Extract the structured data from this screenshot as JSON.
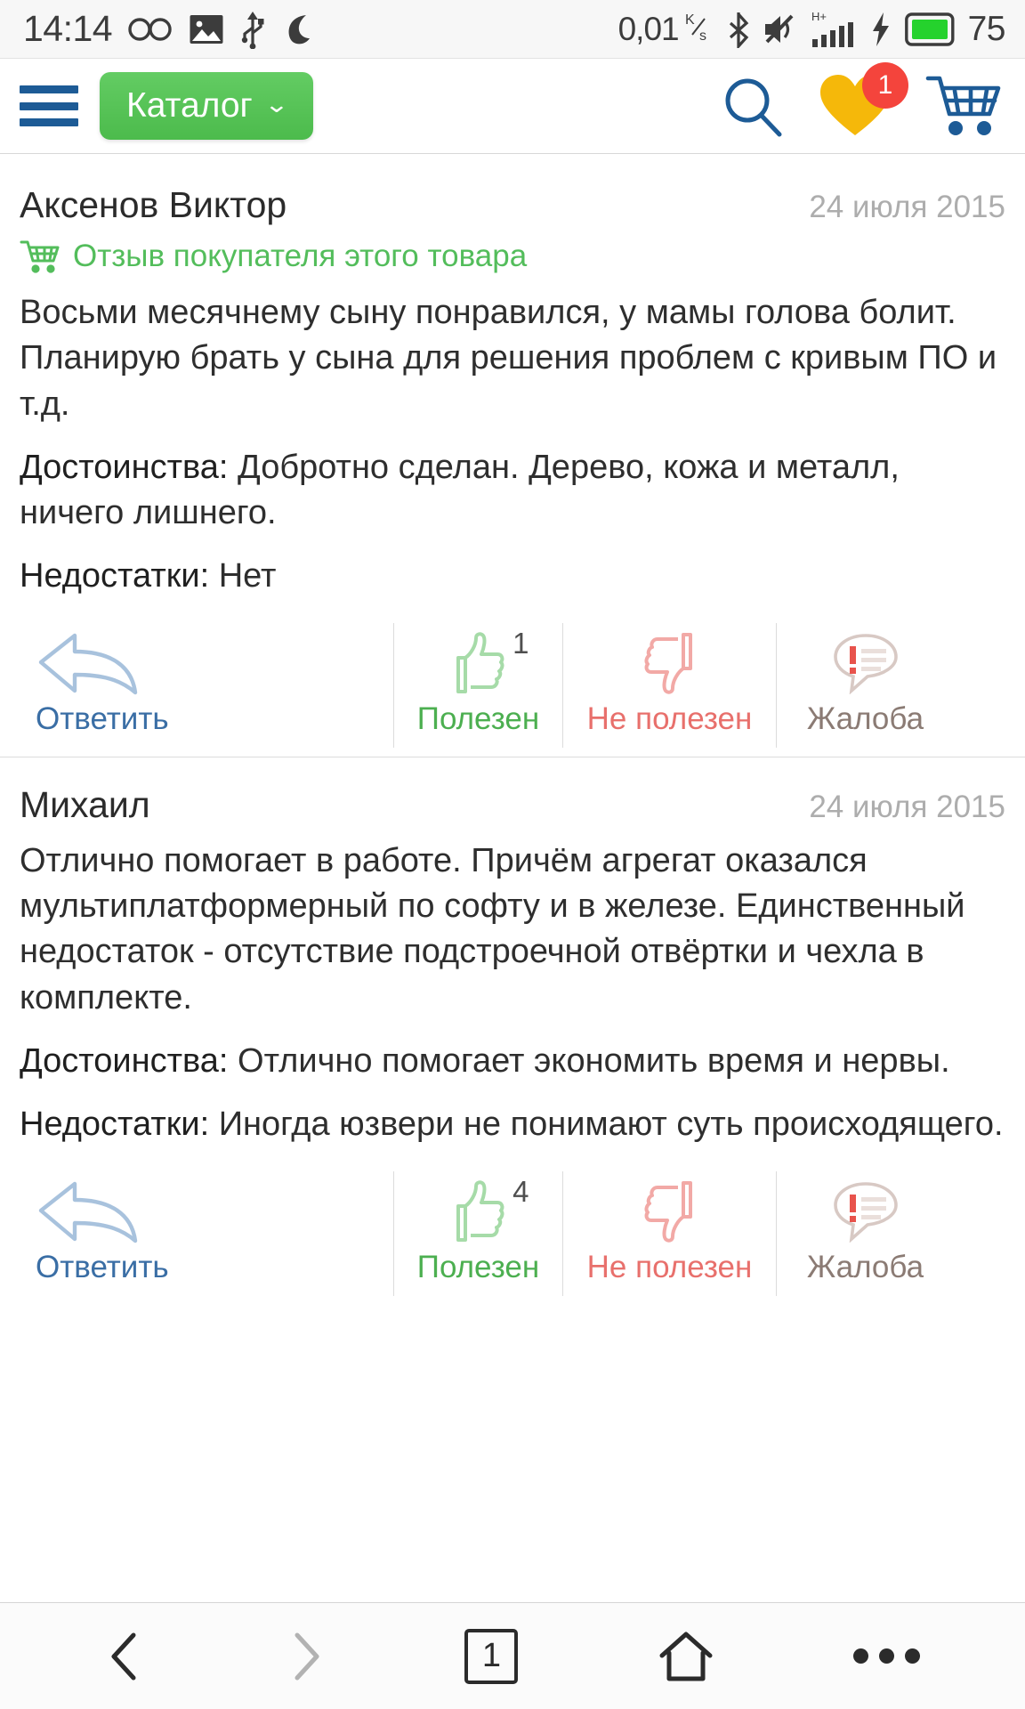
{
  "status_bar": {
    "time": "14:14",
    "network_speed": "0,01",
    "network_speed_unit_top": "K",
    "network_speed_unit_bottom": "s",
    "signal_label": "H+",
    "battery_level": "75",
    "icons": [
      "infinity-icon",
      "image-icon",
      "usb-icon",
      "moon-icon",
      "bluetooth-icon",
      "mute-icon",
      "signal-bars-icon",
      "charging-bolt-icon",
      "battery-icon"
    ],
    "colors": {
      "battery_fill": "#25d22d",
      "text": "#3c3c3c",
      "background": "#f7f7f7"
    }
  },
  "header": {
    "catalog_label": "Каталог",
    "catalog_chevron": "⌄",
    "favorites_badge": "1",
    "colors": {
      "catalog_green": "#4cbb4c",
      "hamburger_blue": "#1d5b96",
      "heart_yellow": "#f5b80a",
      "badge_red": "#f4443c",
      "cart_blue": "#1d5b96"
    }
  },
  "reviews": [
    {
      "author": "Аксенов Виктор",
      "date": "24 июля 2015",
      "buyer_badge": "Отзыв покупателя этого товара",
      "body": "Восьми месячнему сыну понравился, у мамы голова болит. Планирую брать у сына для решения проблем с кривым ПО и т.д.",
      "pros_label": "Достоинства:",
      "pros_text": "Добротно сделан. Дерево, кожа и металл, ничего лишнего.",
      "cons_label": "Недостатки:",
      "cons_text": "Нет",
      "actions": {
        "reply": "Ответить",
        "useful": "Полезен",
        "useful_count": "1",
        "not_useful": "Не полезен",
        "report": "Жалоба"
      }
    },
    {
      "author": "Михаил",
      "date": "24 июля 2015",
      "buyer_badge": "",
      "body": "Отлично помогает в работе. Причём агрегат оказался мультиплатформерный по софту и в железе. Единственный недостаток - отсутствие подстроечной отвёртки и чехла в комплекте.",
      "pros_label": "Достоинства:",
      "pros_text": "Отлично помогает экономить время и нервы.",
      "cons_label": "Недостатки:",
      "cons_text": "Иногда юзвери не понимают суть происходящего.",
      "actions": {
        "reply": "Ответить",
        "useful": "Полезен",
        "useful_count": "4",
        "not_useful": "Не полезен",
        "report": "Жалоба"
      }
    }
  ],
  "bottom_nav": {
    "back_icon": "chevron-left-icon",
    "forward_icon": "chevron-right-icon",
    "tab_count": "1",
    "home_icon": "home-icon",
    "menu_icon": "more-dots-icon"
  }
}
